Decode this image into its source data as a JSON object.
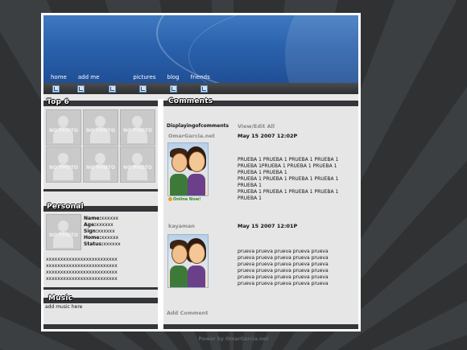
{
  "nav": {
    "items": [
      "home",
      "add me",
      "",
      "pictures",
      "blog",
      "friends"
    ]
  },
  "top6": {
    "title": "Top 6",
    "no_photo_label": "NO PHOTO"
  },
  "personal": {
    "title": "Personal",
    "fields": [
      {
        "label": "Name:",
        "value": "xxxxxx"
      },
      {
        "label": "Age:",
        "value": "xxxxxx"
      },
      {
        "label": "Sign:",
        "value": "xxxxxx"
      },
      {
        "label": "Home:",
        "value": "xxxxxx"
      },
      {
        "label": "Status:",
        "value": "xxxxxx"
      }
    ],
    "bio_lines": [
      "xxxxxxxxxxxxxxxxxxxxxxxxx",
      "xxxxxxxxxxxxxxxxxxxxxxxxx",
      "xxxxxxxxxxxxxxxxxxxxxxxxx",
      "xxxxxxxxxxxxxxxxxxxxxxxxx"
    ]
  },
  "music": {
    "title": "Music",
    "text": "add music here"
  },
  "comments": {
    "title": "Comments",
    "displaying": "Displayingofcomments",
    "view_edit": "View/Edit All",
    "items": [
      {
        "author": "OmarGarcia.net",
        "date": "May 15 2007 12:02P",
        "online": "Online Now!",
        "lines": [
          "PRUEBA 1 PRUEBA 1 PRUEBA 1 PRUEBA 1",
          "PRUEBA 1PRUEBA 1 PRUEBA 1 PRUEBA 1",
          "PRUEBA 1 PRUEBA 1",
          "PRUEBA 1 PRUEBA 1 PRUEBA 1 PRUEBA 1",
          "PRUEBA 1",
          "PRUEBA 1 PRUEBA 1 PRUEBA 1 PRUEBA 1",
          "PRUEBA 1"
        ]
      },
      {
        "author": "kayaman",
        "date": "May 15 2007 12:01P",
        "lines": [
          "prueva prueva prueva prueva prueva",
          "prueva prueva prueva prueva prueva",
          "prueva prueva prueva prueva prueva",
          "prueva prueva prueva prueva prueva",
          "prueva prueva prueva prueva prueva",
          "prueva prueva prueva prueva prueva"
        ]
      }
    ],
    "add_comment": "Add Comment"
  },
  "footer": {
    "text": "Power by OmarGarcia.net"
  },
  "colors": {
    "banner": "#2b62ad",
    "header_bar": "#333538",
    "panel": "#e6e6e6"
  }
}
